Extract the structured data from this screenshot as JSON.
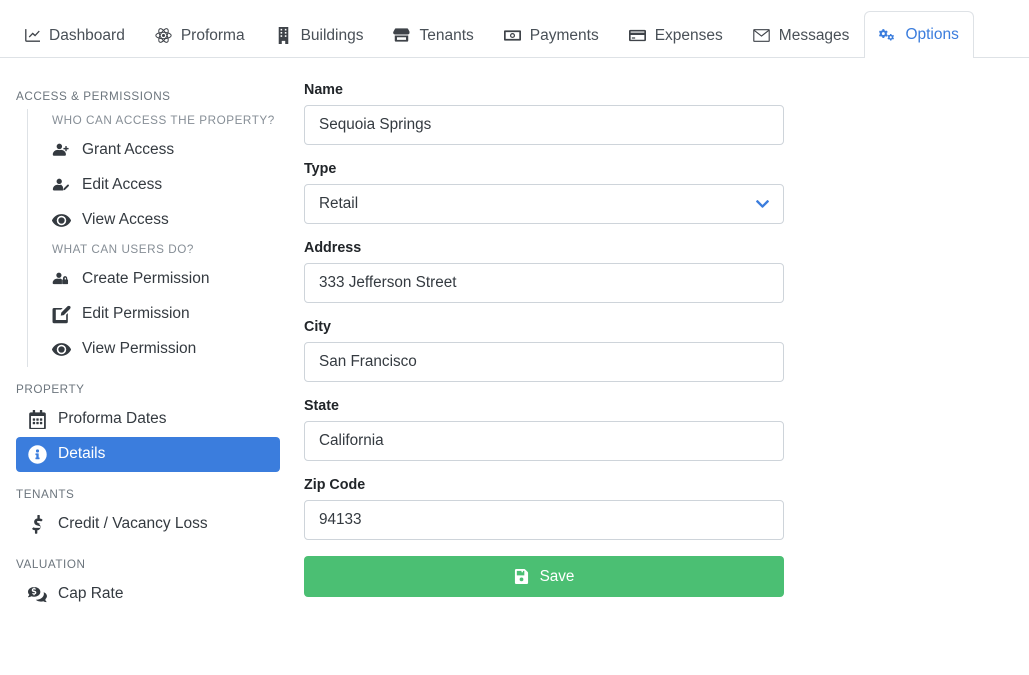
{
  "tabs": [
    {
      "label": "Dashboard",
      "icon": "chart-line-icon",
      "active": false
    },
    {
      "label": "Proforma",
      "icon": "atom-icon",
      "active": false
    },
    {
      "label": "Buildings",
      "icon": "building-icon",
      "active": false
    },
    {
      "label": "Tenants",
      "icon": "store-icon",
      "active": false
    },
    {
      "label": "Payments",
      "icon": "money-bill-icon",
      "active": false
    },
    {
      "label": "Expenses",
      "icon": "credit-card-icon",
      "active": false
    },
    {
      "label": "Messages",
      "icon": "envelope-icon",
      "active": false
    },
    {
      "label": "Options",
      "icon": "cogs-icon",
      "active": true
    }
  ],
  "sidebar": {
    "sections": [
      {
        "header": "ACCESS & PERMISSIONS",
        "groups": [
          {
            "subheader": "WHO CAN ACCESS THE PROPERTY?",
            "items": [
              {
                "label": "Grant Access",
                "icon": "user-plus-icon",
                "active": false
              },
              {
                "label": "Edit Access",
                "icon": "user-edit-icon",
                "active": false
              },
              {
                "label": "View Access",
                "icon": "eye-icon",
                "active": false
              }
            ]
          },
          {
            "subheader": "WHAT CAN USERS DO?",
            "items": [
              {
                "label": "Create Permission",
                "icon": "user-lock-icon",
                "active": false
              },
              {
                "label": "Edit Permission",
                "icon": "pen-square-icon",
                "active": false
              },
              {
                "label": "View Permission",
                "icon": "eye-icon",
                "active": false
              }
            ]
          }
        ]
      },
      {
        "header": "PROPERTY",
        "items": [
          {
            "label": "Proforma Dates",
            "icon": "calendar-icon",
            "active": false
          },
          {
            "label": "Details",
            "icon": "info-circle-icon",
            "active": true
          }
        ]
      },
      {
        "header": "TENANTS",
        "items": [
          {
            "label": "Credit / Vacancy Loss",
            "icon": "dollar-sign-icon",
            "active": false
          }
        ]
      },
      {
        "header": "VALUATION",
        "items": [
          {
            "label": "Cap Rate",
            "icon": "comment-dollar-icon",
            "active": false
          }
        ]
      }
    ]
  },
  "form": {
    "fields": [
      {
        "label": "Name",
        "value": "Sequoia Springs",
        "type": "text"
      },
      {
        "label": "Type",
        "value": "Retail",
        "type": "select"
      },
      {
        "label": "Address",
        "value": "333 Jefferson Street",
        "type": "text"
      },
      {
        "label": "City",
        "value": "San Francisco",
        "type": "text"
      },
      {
        "label": "State",
        "value": "California",
        "type": "text"
      },
      {
        "label": "Zip Code",
        "value": "94133",
        "type": "text"
      }
    ],
    "save_label": "Save"
  },
  "colors": {
    "accent_blue": "#3b7ddd",
    "save_green": "#4bbf73",
    "border_gray": "#ced4da",
    "muted_text": "#6c757d"
  }
}
